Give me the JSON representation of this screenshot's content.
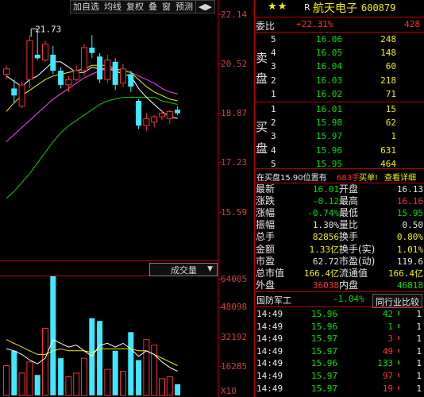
{
  "toolbar": {
    "add_watch": "加自选",
    "ma": "均线",
    "adjust": "复权",
    "overlay": "叠",
    "window": "窗",
    "forecast": "预测",
    "arrows": "◀▶"
  },
  "chart": {
    "high_marker": "21.73",
    "price_axis": [
      "22.14",
      "20.52",
      "18.87",
      "17.23",
      "15.59"
    ],
    "volume_axis": [
      "64005",
      "48098",
      "32192",
      "16285"
    ],
    "volume_unit": "X10",
    "volume_button": "成交量",
    "colors": {
      "up": "#ff3030",
      "down": "#40e8ff",
      "ma5": "#ffffff",
      "ma10": "#f0f000",
      "ma20": "#ff40ff",
      "ma60": "#00d000",
      "grid": "#c00000"
    }
  },
  "chart_data": {
    "type": "candlestick",
    "candles": [
      {
        "o": 20.45,
        "h": 20.7,
        "l": 20.3,
        "c": 20.6
      },
      {
        "o": 20.05,
        "h": 20.3,
        "l": 19.65,
        "c": 19.85
      },
      {
        "o": 19.55,
        "h": 20.25,
        "l": 19.5,
        "c": 20.15
      },
      {
        "o": 20.3,
        "h": 21.55,
        "l": 20.05,
        "c": 21.4
      },
      {
        "o": 21.0,
        "h": 21.73,
        "l": 20.85,
        "c": 20.9
      },
      {
        "o": 20.85,
        "h": 21.4,
        "l": 20.8,
        "c": 21.3
      },
      {
        "o": 21.0,
        "h": 21.25,
        "l": 20.45,
        "c": 20.55
      },
      {
        "o": 20.55,
        "h": 20.65,
        "l": 20.05,
        "c": 20.15
      },
      {
        "o": 20.15,
        "h": 20.4,
        "l": 19.95,
        "c": 20.3
      },
      {
        "o": 20.3,
        "h": 20.7,
        "l": 20.25,
        "c": 20.55
      },
      {
        "o": 20.55,
        "h": 21.3,
        "l": 20.4,
        "c": 21.2
      },
      {
        "o": 21.2,
        "h": 21.55,
        "l": 20.9,
        "c": 21.05
      },
      {
        "o": 20.95,
        "h": 21.05,
        "l": 20.2,
        "c": 20.3
      },
      {
        "o": 20.3,
        "h": 21.0,
        "l": 20.2,
        "c": 20.85
      },
      {
        "o": 20.8,
        "h": 20.9,
        "l": 20.0,
        "c": 20.15
      },
      {
        "o": 20.2,
        "h": 20.75,
        "l": 20.1,
        "c": 20.6
      },
      {
        "o": 20.45,
        "h": 20.55,
        "l": 19.95,
        "c": 20.1
      },
      {
        "o": 19.7,
        "h": 19.75,
        "l": 18.9,
        "c": 19.0
      },
      {
        "o": 19.0,
        "h": 19.35,
        "l": 18.85,
        "c": 19.2
      },
      {
        "o": 19.1,
        "h": 19.3,
        "l": 18.95,
        "c": 19.25
      },
      {
        "o": 19.25,
        "h": 19.45,
        "l": 19.15,
        "c": 19.35
      },
      {
        "o": 19.2,
        "h": 19.45,
        "l": 19.05,
        "c": 19.4
      },
      {
        "o": 19.45,
        "h": 19.55,
        "l": 19.3,
        "c": 19.35
      }
    ],
    "ma5": [
      20.4,
      20.25,
      20.1,
      20.3,
      20.4,
      20.6,
      20.8,
      20.8,
      20.65,
      20.5,
      20.5,
      20.65,
      20.6,
      20.6,
      20.55,
      20.45,
      20.4,
      20.05,
      19.8,
      19.6,
      19.4,
      19.25,
      19.2
    ],
    "ma10": [
      19.4,
      19.65,
      19.85,
      20.0,
      20.15,
      20.3,
      20.4,
      20.45,
      20.5,
      20.55,
      20.6,
      20.7,
      20.7,
      20.7,
      20.6,
      20.55,
      20.5,
      20.3,
      20.1,
      19.95,
      19.85,
      19.75,
      19.7
    ],
    "ma20": [
      18.55,
      18.75,
      18.95,
      19.15,
      19.35,
      19.55,
      19.75,
      19.9,
      20.05,
      20.2,
      20.35,
      20.45,
      20.55,
      20.6,
      20.6,
      20.55,
      20.5,
      20.4,
      20.3,
      20.2,
      20.05,
      19.95,
      19.9
    ],
    "ma60": [
      16.95,
      17.15,
      17.4,
      17.65,
      17.95,
      18.25,
      18.55,
      18.8,
      19.0,
      19.15,
      19.3,
      19.45,
      19.6,
      19.7,
      19.75,
      19.8,
      19.8,
      19.8,
      19.8,
      19.8,
      19.7,
      19.65,
      19.6
    ],
    "volume": [
      16000,
      24000,
      12000,
      18000,
      11000,
      36000,
      64005,
      20000,
      10000,
      12000,
      20000,
      41500,
      40000,
      14000,
      24000,
      13000,
      34000,
      19000,
      30000,
      27000,
      9000,
      10000,
      6000
    ],
    "vol_ma5": [
      25000,
      24000,
      22000,
      19000,
      17000,
      20000,
      30000,
      28000,
      26000,
      27000,
      24000,
      21000,
      27000,
      28000,
      26000,
      28000,
      25000,
      21000,
      24000,
      22000,
      18000,
      15000,
      13000
    ],
    "vol_ma10": [
      30000,
      28000,
      26000,
      24000,
      22000,
      22000,
      24000,
      25000,
      24000,
      24000,
      24000,
      23000,
      25000,
      25000,
      25000,
      25000,
      25000,
      24000,
      24000,
      22000,
      20000,
      18000,
      16000
    ],
    "price_range": [
      15.2,
      22.14
    ],
    "volume_range": [
      0,
      64005
    ]
  },
  "stock": {
    "stars": "★★",
    "r_mark": "R",
    "name": "航天电子",
    "code": "600879"
  },
  "weibi": {
    "label": "委比",
    "pct": "+22.31%",
    "diff": "428"
  },
  "sell_label": [
    "卖",
    "盘"
  ],
  "buy_label": [
    "买",
    "盘"
  ],
  "sell_orders": [
    {
      "level": "5",
      "price": "16.06",
      "vol": "248"
    },
    {
      "level": "4",
      "price": "16.05",
      "vol": "148"
    },
    {
      "level": "3",
      "price": "16.04",
      "vol": "60"
    },
    {
      "level": "2",
      "price": "16.03",
      "vol": "218"
    },
    {
      "level": "1",
      "price": "16.02",
      "vol": "71"
    }
  ],
  "buy_orders": [
    {
      "level": "1",
      "price": "16.01",
      "vol": "15"
    },
    {
      "level": "2",
      "price": "15.98",
      "vol": "62"
    },
    {
      "level": "3",
      "price": "15.97",
      "vol": "1"
    },
    {
      "level": "4",
      "price": "15.96",
      "vol": "631"
    },
    {
      "level": "5",
      "price": "15.95",
      "vol": "464"
    }
  ],
  "info_bar": {
    "text": "在买盘15.90位置有",
    "count": "683手",
    "action": "买单!",
    "detail": "查看详细"
  },
  "stats": [
    {
      "k1": "最新",
      "v1": "16.01",
      "c1": "green",
      "k2": "开盘",
      "v2": "16.13",
      "c2": "white"
    },
    {
      "k1": "涨跌",
      "v1": "-0.12",
      "c1": "green",
      "k2": "最高",
      "v2": "16.16",
      "c2": "red"
    },
    {
      "k1": "涨幅",
      "v1": "-0.74%",
      "c1": "green",
      "k2": "最低",
      "v2": "15.95",
      "c2": "green"
    },
    {
      "k1": "振幅",
      "v1": "1.30%",
      "c1": "white",
      "k2": "量比",
      "v2": "0.50",
      "c2": "white"
    },
    {
      "k1": "总手",
      "v1": "82856",
      "c1": "yellow",
      "k2": "换手",
      "v2": "0.80%",
      "c2": "yellow"
    },
    {
      "k1": "金额",
      "v1": "1.33亿",
      "c1": "yellow",
      "k2": "换手(实)",
      "v2": "1.01%",
      "c2": "yellow"
    },
    {
      "k1": "市盈",
      "v1": "62.72",
      "c1": "white",
      "k2": "市盈(动)",
      "v2": "119.6",
      "c2": "white"
    },
    {
      "k1": "总市值",
      "v1": "166.4亿",
      "c1": "yellow",
      "k2": "流通值",
      "v2": "166.4亿",
      "c2": "yellow"
    },
    {
      "k1": "外盘",
      "v1": "36038",
      "c1": "red",
      "k2": "内盘",
      "v2": "46818",
      "c2": "green"
    }
  ],
  "sector": {
    "name": "国防军工",
    "change": "-1.04%",
    "peer_button": "同行业比较"
  },
  "ticks": [
    {
      "time": "14:49",
      "price": "15.96",
      "vol": "42",
      "dir": "down",
      "n": "1"
    },
    {
      "time": "14:49",
      "price": "15.96",
      "vol": "1",
      "dir": "down",
      "n": "1"
    },
    {
      "time": "14:49",
      "price": "15.97",
      "vol": "3",
      "dir": "up",
      "n": "1"
    },
    {
      "time": "14:49",
      "price": "15.97",
      "vol": "49",
      "dir": "up",
      "n": "1"
    },
    {
      "time": "14:49",
      "price": "15.96",
      "vol": "133",
      "dir": "down",
      "n": "1"
    },
    {
      "time": "14:49",
      "price": "15.97",
      "vol": "97",
      "dir": "up",
      "n": "1"
    },
    {
      "time": "14:49",
      "price": "15.97",
      "vol": "19",
      "dir": "up",
      "n": "1"
    }
  ]
}
